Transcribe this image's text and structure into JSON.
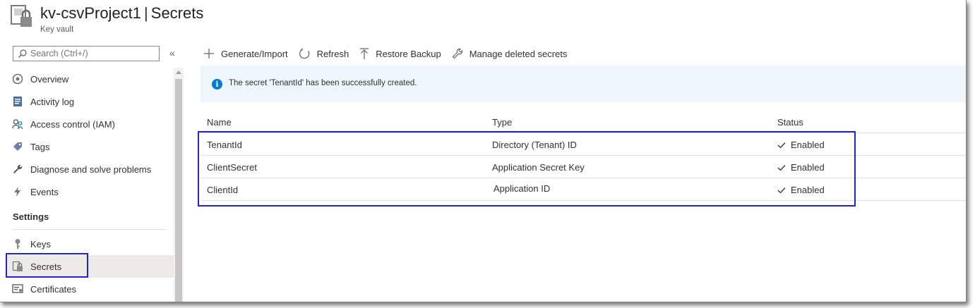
{
  "header": {
    "resource_name": "kv-csvProject1",
    "separator": "|",
    "page": "Secrets",
    "resource_type": "Key vault"
  },
  "search": {
    "placeholder": "Search (Ctrl+/)"
  },
  "sidebar": {
    "collapse_glyph": "«",
    "items": [
      {
        "label": "Overview",
        "icon": "overview-icon"
      },
      {
        "label": "Activity log",
        "icon": "activity-log-icon"
      },
      {
        "label": "Access control (IAM)",
        "icon": "access-control-icon"
      },
      {
        "label": "Tags",
        "icon": "tag-icon"
      },
      {
        "label": "Diagnose and solve problems",
        "icon": "wrench-icon"
      },
      {
        "label": "Events",
        "icon": "lightning-icon"
      }
    ],
    "section": "Settings",
    "settings_items": [
      {
        "label": "Keys",
        "icon": "key-icon"
      },
      {
        "label": "Secrets",
        "icon": "secret-icon",
        "active": true
      },
      {
        "label": "Certificates",
        "icon": "certificate-icon"
      }
    ]
  },
  "toolbar": {
    "generate": "Generate/Import",
    "refresh": "Refresh",
    "restore": "Restore Backup",
    "manage": "Manage deleted secrets"
  },
  "notification": {
    "text": "The secret 'TenantId' has been successfully created.",
    "icon": "info-icon"
  },
  "table": {
    "columns": [
      "Name",
      "Type",
      "Status"
    ],
    "rows": [
      {
        "name": "TenantId",
        "type": "Directory (Tenant) ID",
        "status": "Enabled"
      },
      {
        "name": "ClientSecret",
        "type": "Application Secret Key",
        "status": "Enabled"
      },
      {
        "name": "ClientId",
        "type": "Application ID",
        "status": "Enabled"
      }
    ]
  },
  "colors": {
    "accent": "#0078d4",
    "highlight": "#1f25c9",
    "notice_bg": "#eff6fc"
  }
}
